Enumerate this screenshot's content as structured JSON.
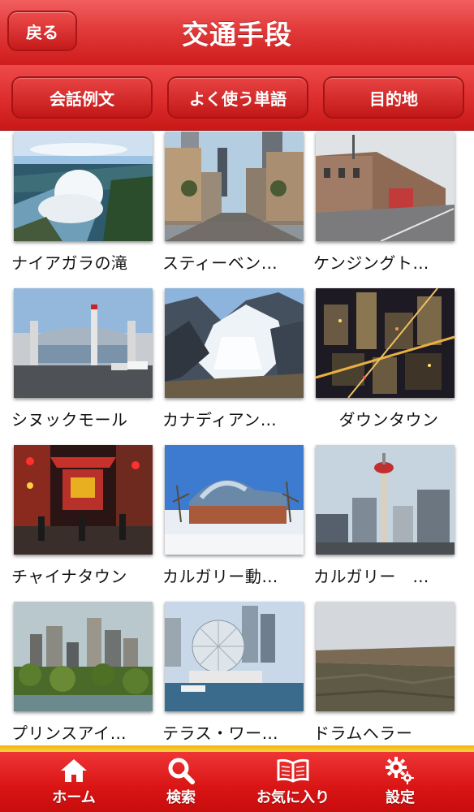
{
  "header": {
    "back_label": "戻る",
    "title": "交通手段"
  },
  "segments": [
    {
      "label": "会話例文"
    },
    {
      "label": "よく使う単語"
    },
    {
      "label": "目的地"
    }
  ],
  "places": [
    {
      "caption": "ナイアガラの滝",
      "image": "niagara-falls-photo"
    },
    {
      "caption": "スティーベン…",
      "image": "stephen-avenue-photo"
    },
    {
      "caption": "ケンジングト…",
      "image": "kensington-street-photo"
    },
    {
      "caption": "シヌックモール",
      "image": "chinook-mall-photo"
    },
    {
      "caption": "カナディアン…",
      "image": "canadian-rockies-glacier-photo"
    },
    {
      "caption": "ダウンタウン",
      "image": "downtown-night-photo"
    },
    {
      "caption": "チャイナタウン",
      "image": "chinatown-photo"
    },
    {
      "caption": "カルガリー動…",
      "image": "calgary-zoo-photo"
    },
    {
      "caption": "カルガリー　…",
      "image": "calgary-tower-photo"
    },
    {
      "caption": "プリンスアイ…",
      "image": "prince-island-photo"
    },
    {
      "caption": "テラス・ワー…",
      "image": "science-world-photo"
    },
    {
      "caption": "ドラムヘラー",
      "image": "drumheller-photo"
    }
  ],
  "tabbar": {
    "tabs": [
      {
        "label": "ホーム",
        "icon": "home-icon"
      },
      {
        "label": "検索",
        "icon": "search-icon"
      },
      {
        "label": "お気に入り",
        "icon": "book-icon"
      },
      {
        "label": "設定",
        "icon": "gear-icon"
      }
    ]
  },
  "colors": {
    "header_red": "#d92424",
    "tab_red": "#d91414",
    "accent_gold": "#f4b400"
  }
}
